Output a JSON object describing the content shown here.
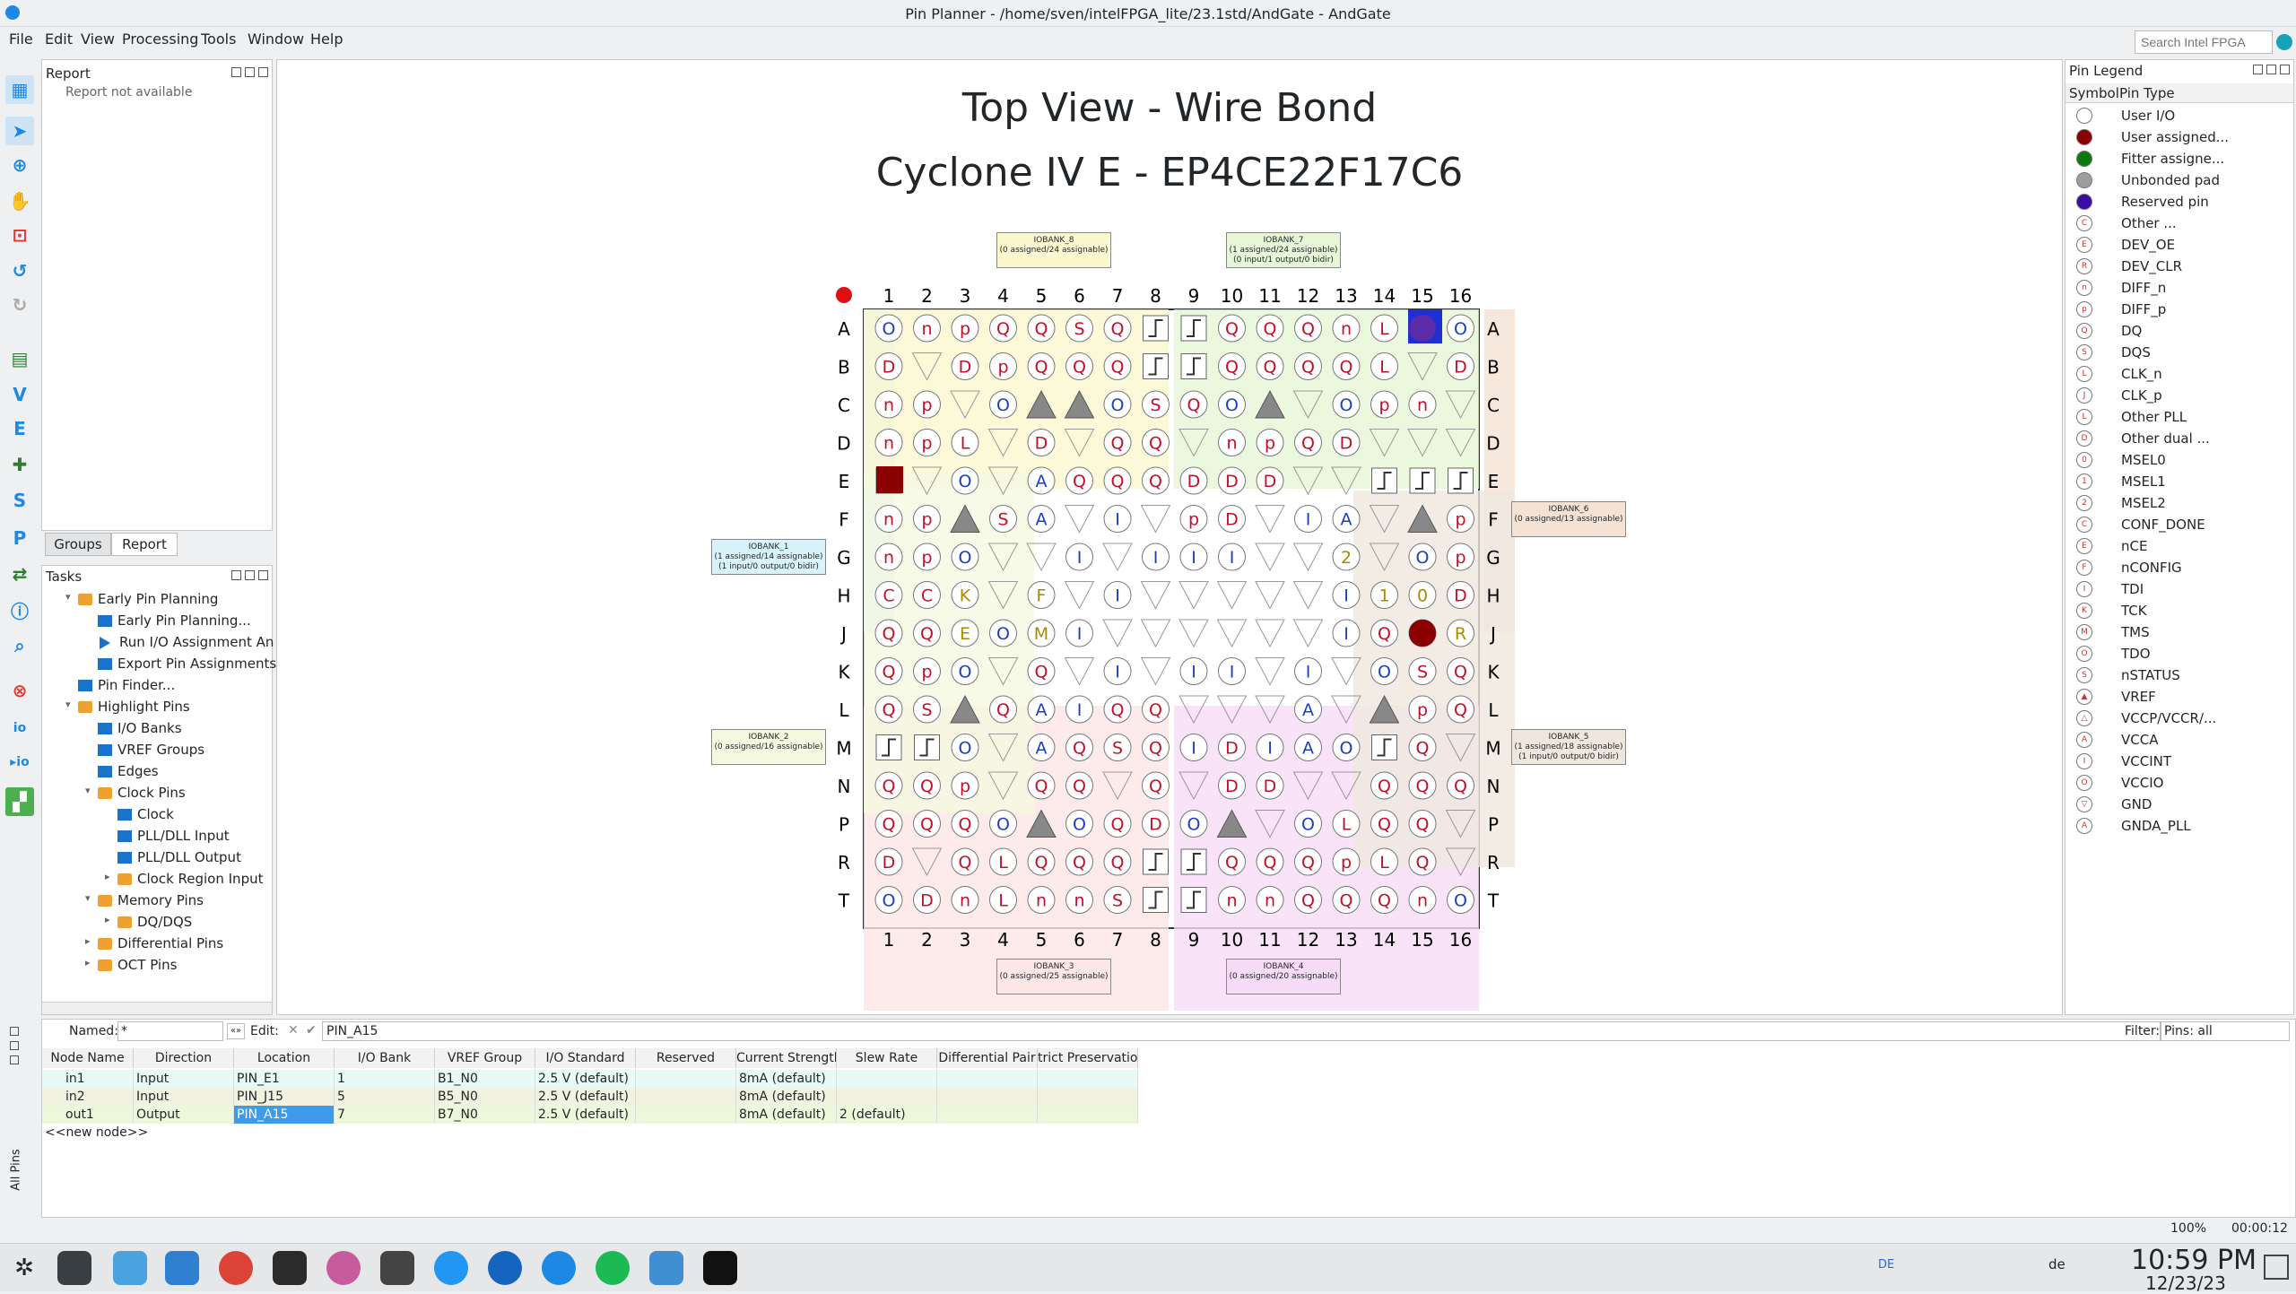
{
  "window": {
    "title": "Pin Planner - /home/sven/intelFPGA_lite/23.1std/AndGate - AndGate"
  },
  "menu": [
    "File",
    "Edit",
    "View",
    "Processing",
    "Tools",
    "Window",
    "Help"
  ],
  "search": {
    "placeholder": "Search Intel FPGA"
  },
  "report_panel": {
    "title": "Report",
    "message": "Report not available"
  },
  "left_tabs": [
    "Groups",
    "Report"
  ],
  "tasks_panel": {
    "title": "Tasks",
    "items": [
      {
        "label": "Early Pin Planning",
        "level": 1,
        "icon": "folder",
        "expand": "open"
      },
      {
        "label": "Early Pin Planning...",
        "level": 2,
        "icon": "grid",
        "expand": ""
      },
      {
        "label": "Run I/O Assignment An",
        "level": 2,
        "icon": "run",
        "expand": ""
      },
      {
        "label": "Export Pin Assignments",
        "level": 2,
        "icon": "grid",
        "expand": ""
      },
      {
        "label": "Pin Finder...",
        "level": 1,
        "icon": "grid",
        "expand": ""
      },
      {
        "label": "Highlight Pins",
        "level": 1,
        "icon": "folder",
        "expand": "open"
      },
      {
        "label": "I/O Banks",
        "level": 2,
        "icon": "grid",
        "expand": ""
      },
      {
        "label": "VREF Groups",
        "level": 2,
        "icon": "grid",
        "expand": ""
      },
      {
        "label": "Edges",
        "level": 2,
        "icon": "grid",
        "expand": ""
      },
      {
        "label": "Clock Pins",
        "level": 2,
        "icon": "folder",
        "expand": "open"
      },
      {
        "label": "Clock",
        "level": 3,
        "icon": "grid",
        "expand": ""
      },
      {
        "label": "PLL/DLL Input",
        "level": 3,
        "icon": "grid",
        "expand": ""
      },
      {
        "label": "PLL/DLL Output",
        "level": 3,
        "icon": "grid",
        "expand": ""
      },
      {
        "label": "Clock Region Input",
        "level": 3,
        "icon": "folder",
        "expand": "closed"
      },
      {
        "label": "Memory Pins",
        "level": 2,
        "icon": "folder",
        "expand": "open"
      },
      {
        "label": "DQ/DQS",
        "level": 3,
        "icon": "folder",
        "expand": "closed"
      },
      {
        "label": "Differential Pins",
        "level": 2,
        "icon": "folder",
        "expand": "closed"
      },
      {
        "label": "OCT Pins",
        "level": 2,
        "icon": "folder",
        "expand": "closed"
      }
    ]
  },
  "package": {
    "title1": "Top View - Wire Bond",
    "title2": "Cyclone IV E - EP4CE22F17C6",
    "cols": [
      "1",
      "2",
      "3",
      "4",
      "5",
      "6",
      "7",
      "8",
      "9",
      "10",
      "11",
      "12",
      "13",
      "14",
      "15",
      "16"
    ],
    "rows": [
      "A",
      "B",
      "C",
      "D",
      "E",
      "F",
      "G",
      "H",
      "J",
      "K",
      "L",
      "M",
      "N",
      "P",
      "R",
      "T"
    ],
    "pins": [
      "OnpQQSQ]]QQQnLDO",
      "D.DpQQQ]]QQQQL.D",
      "np.O^^OSQO^.Opn",
      "npL.D.QQ.npQD.",
      "].O.AQQQDDD..]]]",
      "np^SA.I.pD.IA.^pn",
      "npO..I.III..2.Opn",
      "CCK.F.I.....I10D.",
      "QQEOMI......IQQRE",
      "QpO.Q.I.II.I.OSQ",
      "QS^QAIQQ...A.^pQ",
      "]]O.AQSQIDIAO]Q",
      "QQp.QQ.Q.DD..QQQ",
      "QQQO^OQDO^.OLQQ",
      "D.QLQQQ]]QQQpLQ.",
      "ODnLnnS]]nnQQQnO"
    ],
    "banks": [
      {
        "name": "IOBANK_8",
        "info": "(0 assigned/24 assignable)"
      },
      {
        "name": "IOBANK_7",
        "info": "(1 assigned/24 assignable)",
        "info2": "(0 input/1 output/0 bidir)"
      },
      {
        "name": "IOBANK_1",
        "info": "(1 assigned/14 assignable)",
        "info2": "(1 input/0 output/0 bidir)"
      },
      {
        "name": "IOBANK_2",
        "info": "(0 assigned/16 assignable)"
      },
      {
        "name": "IOBANK_6",
        "info": "(0 assigned/13 assignable)"
      },
      {
        "name": "IOBANK_5",
        "info": "(1 assigned/18 assignable)",
        "info2": "(1 input/0 output/0 bidir)"
      },
      {
        "name": "IOBANK_3",
        "info": "(0 assigned/25 assignable)"
      },
      {
        "name": "IOBANK_4",
        "info": "(0 assigned/20 assignable)"
      }
    ]
  },
  "legend": {
    "title": "Pin Legend",
    "col_symbol": "Symbol",
    "col_type": "Pin Type",
    "items": [
      {
        "sym": "",
        "label": "User I/O",
        "color": "#ffffff"
      },
      {
        "sym": "",
        "label": "User assigned...",
        "color": "#8b0000"
      },
      {
        "sym": "",
        "label": "Fitter assigne...",
        "color": "#0a7a0a"
      },
      {
        "sym": "",
        "label": "Unbonded pad",
        "color": "#9e9e9e"
      },
      {
        "sym": "",
        "label": "Reserved pin",
        "color": "#3a0ca3"
      },
      {
        "sym": "C",
        "label": "Other ...",
        "color": ""
      },
      {
        "sym": "E",
        "label": "DEV_OE",
        "color": ""
      },
      {
        "sym": "R",
        "label": "DEV_CLR",
        "color": ""
      },
      {
        "sym": "n",
        "label": "DIFF_n",
        "color": ""
      },
      {
        "sym": "p",
        "label": "DIFF_p",
        "color": ""
      },
      {
        "sym": "Q",
        "label": "DQ",
        "color": ""
      },
      {
        "sym": "S",
        "label": "DQS",
        "color": ""
      },
      {
        "sym": "L",
        "label": "CLK_n",
        "color": ""
      },
      {
        "sym": "J",
        "label": "CLK_p",
        "color": ""
      },
      {
        "sym": "L",
        "label": "Other PLL",
        "color": ""
      },
      {
        "sym": "D",
        "label": "Other dual ...",
        "color": ""
      },
      {
        "sym": "0",
        "label": "MSEL0",
        "color": ""
      },
      {
        "sym": "1",
        "label": "MSEL1",
        "color": ""
      },
      {
        "sym": "2",
        "label": "MSEL2",
        "color": ""
      },
      {
        "sym": "C",
        "label": "CONF_DONE",
        "color": ""
      },
      {
        "sym": "E",
        "label": "nCE",
        "color": ""
      },
      {
        "sym": "F",
        "label": "nCONFIG",
        "color": ""
      },
      {
        "sym": "I",
        "label": "TDI",
        "color": ""
      },
      {
        "sym": "K",
        "label": "TCK",
        "color": ""
      },
      {
        "sym": "M",
        "label": "TMS",
        "color": ""
      },
      {
        "sym": "O",
        "label": "TDO",
        "color": ""
      },
      {
        "sym": "S",
        "label": "nSTATUS",
        "color": ""
      },
      {
        "sym": "▲",
        "label": "VREF",
        "color": ""
      },
      {
        "sym": "△",
        "label": "VCCP/VCCR/...",
        "color": ""
      },
      {
        "sym": "A",
        "label": "VCCA",
        "color": ""
      },
      {
        "sym": "I",
        "label": "VCCINT",
        "color": ""
      },
      {
        "sym": "O",
        "label": "VCCIO",
        "color": ""
      },
      {
        "sym": "▽",
        "label": "GND",
        "color": ""
      },
      {
        "sym": "A",
        "label": "GNDA_PLL",
        "color": ""
      }
    ]
  },
  "filterbar": {
    "named_label": "Named:",
    "named_value": "*",
    "edit_label": "Edit:",
    "edit_value": "PIN_A15",
    "filter_label": "Filter:",
    "filter_value": "Pins: all"
  },
  "table": {
    "headers": [
      "Node Name",
      "Direction",
      "Location",
      "I/O Bank",
      "VREF Group",
      "I/O Standard",
      "Reserved",
      "Current Strength",
      "Slew Rate",
      "Differential Pair",
      "trict Preservatio"
    ],
    "rows": [
      [
        "in1",
        "Input",
        "PIN_E1",
        "1",
        "B1_N0",
        "2.5 V (default)",
        "",
        "8mA (default)",
        "",
        "",
        ""
      ],
      [
        "in2",
        "Input",
        "PIN_J15",
        "5",
        "B5_N0",
        "2.5 V (default)",
        "",
        "8mA (default)",
        "",
        "",
        ""
      ],
      [
        "out1",
        "Output",
        "PIN_A15",
        "7",
        "B7_N0",
        "2.5 V (default)",
        "",
        "8mA (default)",
        "2 (default)",
        "",
        ""
      ]
    ],
    "new_node": "<<new node>>",
    "side_label": "All Pins"
  },
  "status": {
    "zoom": "100%",
    "elapsed": "00:00:12"
  },
  "taskbar": {
    "time": "10:59 PM",
    "date": "12/23/23",
    "lang": "DE",
    "lang2": "de"
  }
}
